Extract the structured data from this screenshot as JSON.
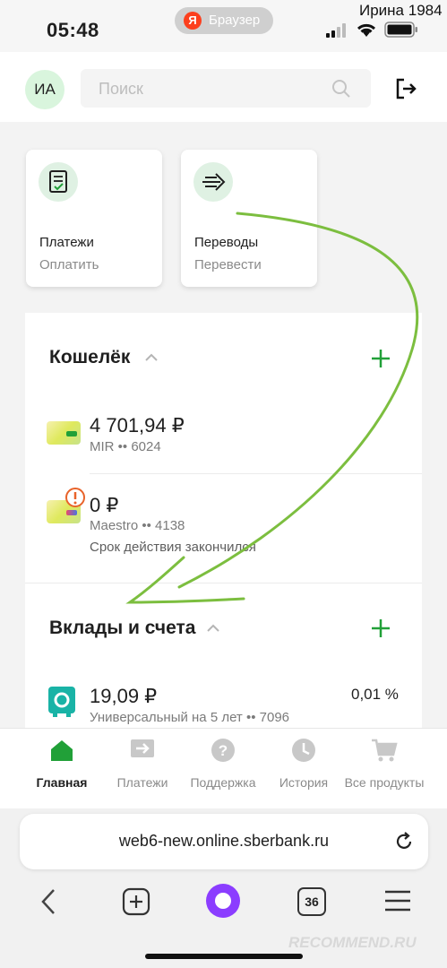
{
  "status_bar": {
    "time": "05:48",
    "browser_pill": "Браузер",
    "yandex_letter": "Я",
    "username": "Ирина 1984"
  },
  "header": {
    "avatar_initials": "ИА",
    "search_placeholder": "Поиск"
  },
  "tiles": [
    {
      "title": "Платежи",
      "subtitle": "Оплатить",
      "icon": "invoice-icon"
    },
    {
      "title": "Переводы",
      "subtitle": "Перевести",
      "icon": "transfer-arrow-icon"
    }
  ],
  "wallet": {
    "title": "Кошелёк",
    "cards": [
      {
        "amount": "4 701,94 ₽",
        "line": "MIR •• 6024"
      },
      {
        "amount": "0 ₽",
        "line": "Maestro •• 4138",
        "warning": "Срок действия закончился"
      }
    ]
  },
  "deposits": {
    "title": "Вклады и счета",
    "items": [
      {
        "amount": "19,09 ₽",
        "line": "Универсальный на 5 лет •• 7096",
        "rate": "0,01 %"
      }
    ]
  },
  "bottom_nav": [
    {
      "label": "Главная",
      "icon": "home-icon",
      "active": true
    },
    {
      "label": "Платежи",
      "icon": "payments-icon"
    },
    {
      "label": "Поддержка",
      "icon": "question-icon"
    },
    {
      "label": "История",
      "icon": "clock-icon"
    },
    {
      "label": "Все продукты",
      "icon": "cart-icon"
    }
  ],
  "browser": {
    "url": "web6-new.online.sberbank.ru",
    "tab_count": "36",
    "watermark": "RECOMMEND.RU"
  },
  "colors": {
    "accent_green": "#21a038",
    "annotation_green": "#7cbe3f",
    "alice_purple": "#8b3dff",
    "warning_orange": "#e8632a"
  }
}
